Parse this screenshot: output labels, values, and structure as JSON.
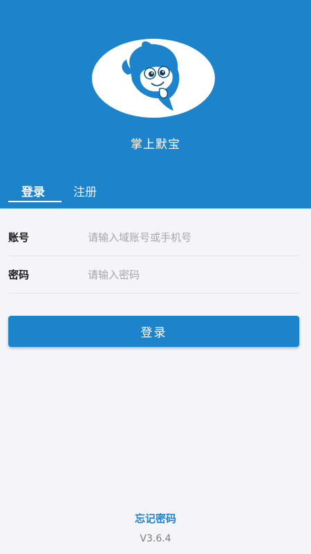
{
  "app": {
    "name": "掌上默宝"
  },
  "tabs": [
    {
      "label": "登录",
      "active": true
    },
    {
      "label": "注册",
      "active": false
    }
  ],
  "form": {
    "account": {
      "label": "账号",
      "placeholder": "请输入域账号或手机号",
      "value": ""
    },
    "password": {
      "label": "密码",
      "placeholder": "请输入密码",
      "value": ""
    }
  },
  "login_button": {
    "label": "登录"
  },
  "forgot_password": {
    "label": "忘记密码"
  },
  "version": {
    "text": "V3.6.4"
  },
  "colors": {
    "primary": "#1d84cc",
    "background": "#f5f5f9"
  }
}
